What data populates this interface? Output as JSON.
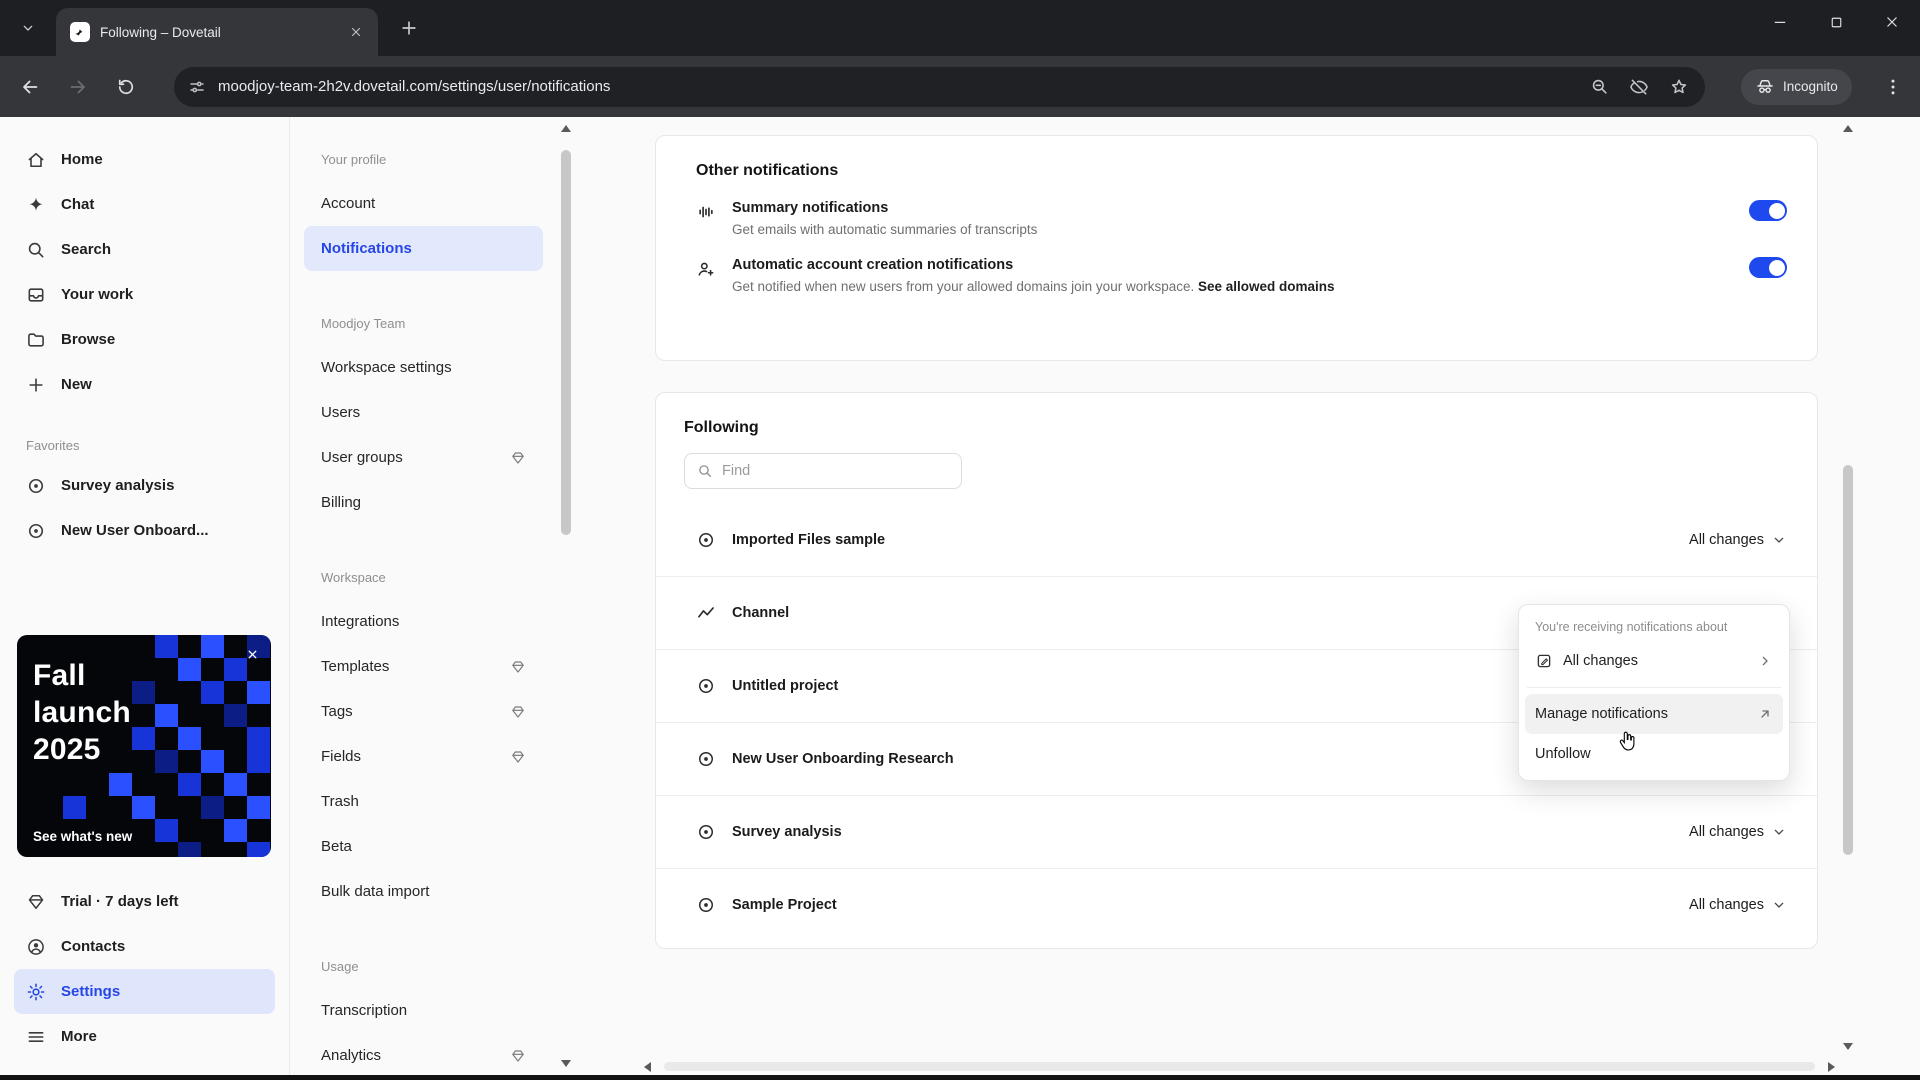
{
  "browser": {
    "tab_title": "Following – Dovetail",
    "url": "moodjoy-team-2h2v.dovetail.com/settings/user/notifications",
    "incognito_label": "Incognito"
  },
  "sidebar": {
    "items": [
      {
        "label": "Home"
      },
      {
        "label": "Chat"
      },
      {
        "label": "Search"
      },
      {
        "label": "Your work"
      },
      {
        "label": "Browse"
      },
      {
        "label": "New"
      }
    ],
    "favorites_label": "Favorites",
    "favorites": [
      {
        "label": "Survey analysis"
      },
      {
        "label": "New User Onboard..."
      }
    ],
    "promo": {
      "title_lines": [
        "Fall",
        "launch",
        "2025"
      ],
      "cta": "See what's new"
    },
    "footer": [
      {
        "label": "Trial · 7 days left"
      },
      {
        "label": "Contacts"
      },
      {
        "label": "Settings"
      },
      {
        "label": "More"
      }
    ]
  },
  "settings_nav": {
    "sections": [
      {
        "heading": "Your profile",
        "items": [
          {
            "label": "Account"
          },
          {
            "label": "Notifications"
          }
        ]
      },
      {
        "heading": "Moodjoy Team",
        "items": [
          {
            "label": "Workspace settings"
          },
          {
            "label": "Users"
          },
          {
            "label": "User groups"
          },
          {
            "label": "Billing"
          }
        ]
      },
      {
        "heading": "Workspace",
        "items": [
          {
            "label": "Integrations"
          },
          {
            "label": "Templates"
          },
          {
            "label": "Tags"
          },
          {
            "label": "Fields"
          },
          {
            "label": "Trash"
          },
          {
            "label": "Beta"
          },
          {
            "label": "Bulk data import"
          }
        ]
      },
      {
        "heading": "Usage",
        "items": [
          {
            "label": "Transcription"
          },
          {
            "label": "Analytics"
          }
        ]
      }
    ]
  },
  "main": {
    "other_notifications": {
      "title": "Other notifications",
      "rows": [
        {
          "title": "Summary notifications",
          "description": "Get emails with automatic summaries of transcripts",
          "toggle": "on"
        },
        {
          "title": "Automatic account creation notifications",
          "description": "Get notified when new users from your allowed domains join your workspace.",
          "link": "See allowed domains",
          "toggle": "on"
        }
      ]
    },
    "following": {
      "title": "Following",
      "search_placeholder": "Find",
      "rows": [
        {
          "name": "Imported Files sample",
          "value": "All changes"
        },
        {
          "name": "Channel"
        },
        {
          "name": "Untitled project"
        },
        {
          "name": "New User Onboarding Research"
        },
        {
          "name": "Survey analysis",
          "value": "All changes"
        },
        {
          "name": "Sample Project",
          "value": "All changes"
        }
      ]
    },
    "popup": {
      "header": "You're receiving notifications about",
      "items": [
        {
          "label": "All changes"
        },
        {
          "label": "Manage notifications"
        },
        {
          "label": "Unfollow"
        }
      ]
    }
  },
  "colors": {
    "accent_blue": "#2746e6",
    "toggle_on": "#1d49ee",
    "selected_bg": "#e3e9fc",
    "promo_pixel_blue": "#2b50ff"
  }
}
